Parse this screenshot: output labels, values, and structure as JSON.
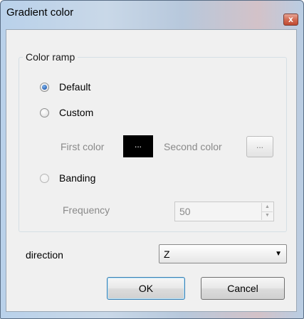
{
  "window": {
    "title": "Gradient color",
    "close_glyph": "x"
  },
  "color_ramp": {
    "legend": "Color ramp",
    "options": [
      {
        "label": "Default",
        "checked": true,
        "enabled": true
      },
      {
        "label": "Custom",
        "checked": false,
        "enabled": true
      },
      {
        "label": "Banding",
        "checked": false,
        "enabled": true
      }
    ],
    "first_color_label": "First color",
    "first_color_value": "#000000",
    "first_color_button": "...",
    "second_color_label": "Second color",
    "second_color_button": "...",
    "frequency_label": "Frequency",
    "frequency_value": "50"
  },
  "direction": {
    "label": "direction",
    "selected": "Z"
  },
  "buttons": {
    "ok": "OK",
    "cancel": "Cancel"
  },
  "icons": {
    "close": "close-icon",
    "radio": "radio-icon",
    "dropdown": "chevron-down-icon",
    "spin_up": "triangle-up-icon",
    "spin_down": "triangle-down-icon"
  },
  "colors": {
    "titlebar_start": "#b9d1ea",
    "titlebar_end": "#d3c2c8",
    "client_bg": "#f0f0f0",
    "radio_checked": "#2a64b8",
    "disabled_text": "#8a8a8a"
  }
}
